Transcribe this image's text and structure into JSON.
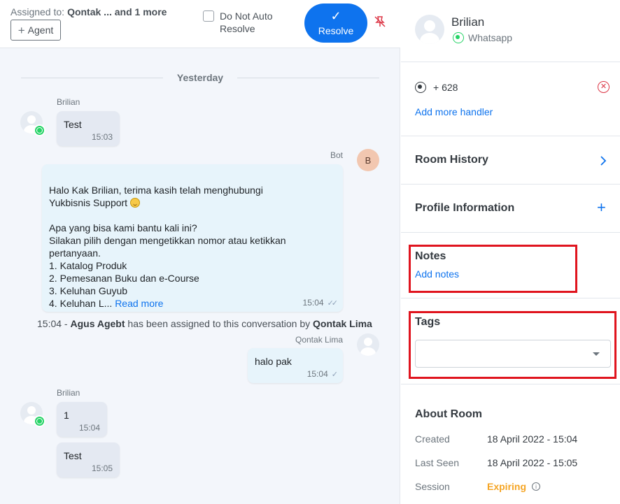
{
  "header": {
    "assigned_label": "Assigned to:",
    "assigned_value": "Qontak ... and 1 more",
    "add_agent_label": "Agent",
    "auto_resolve_label": "Do Not Auto Resolve",
    "resolve_label": "Resolve"
  },
  "chat": {
    "day_separator": "Yesterday",
    "messages": [
      {
        "sender": "Brilian",
        "text": "Test",
        "time": "15:03"
      },
      {
        "sender": "Bot",
        "avatar_initial": "B",
        "text_line1": "Halo Kak Brilian, terima kasih telah menghubungi",
        "text_line2": "Yukbisnis Support",
        "text_body": "Apa yang bisa kami bantu kali ini?\nSilakan pilih dengan mengetikkan nomor atau ketikkan\npertanyaan.\n1. Katalog Produk\n2. Pemesanan Buku dan e-Course\n3. Keluhan Guyub\n4. Keluhan L...",
        "read_more": "Read more",
        "time": "15:04"
      },
      {
        "sender": "Qontak Lima",
        "text": "halo pak",
        "time": "15:04"
      },
      {
        "sender": "Brilian",
        "text": "1",
        "time": "15:04"
      },
      {
        "text": "Test",
        "time": "15:05"
      }
    ],
    "system_message": {
      "time": "15:04 -",
      "agent": "Agus Agebt",
      "middle": "has been assigned to this conversation by",
      "by": "Qontak Lima"
    }
  },
  "contact": {
    "name": "Brilian",
    "channel": "Whatsapp",
    "phone": "+ 628",
    "add_handler": "Add more handler"
  },
  "panel": {
    "room_history": "Room History",
    "profile_information": "Profile Information",
    "notes_title": "Notes",
    "add_notes": "Add notes",
    "tags_title": "Tags",
    "about_title": "About Room",
    "about": {
      "created_label": "Created",
      "created_value": "18 April 2022 - 15:04",
      "last_seen_label": "Last Seen",
      "last_seen_value": "18 April 2022 - 15:05",
      "session_label": "Session",
      "session_value": "Expiring"
    }
  },
  "colors": {
    "accent": "#0e73ee",
    "whatsapp": "#25d366",
    "highlight": "#e0141e",
    "expiring": "#f5a524"
  }
}
